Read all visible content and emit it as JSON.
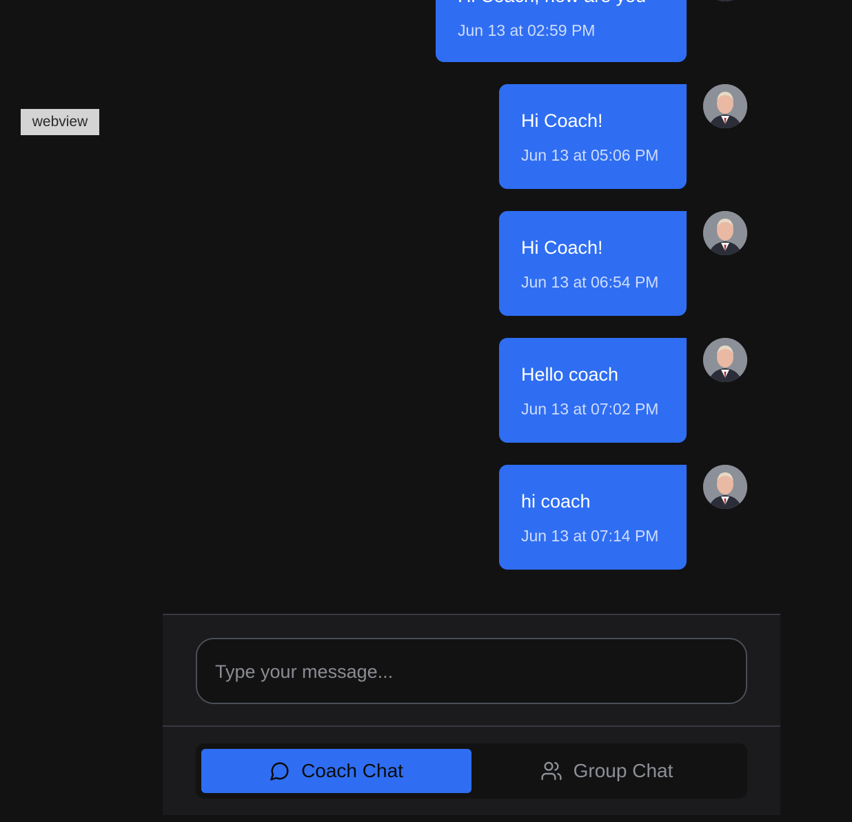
{
  "webview_label": "webview",
  "messages": [
    {
      "text": "Hi Coach, how are you",
      "time": "Jun 13 at 02:59 PM"
    },
    {
      "text": "Hi Coach!",
      "time": "Jun 13 at 05:06 PM"
    },
    {
      "text": "Hi Coach!",
      "time": "Jun 13 at 06:54 PM"
    },
    {
      "text": "Hello coach",
      "time": "Jun 13 at 07:02 PM"
    },
    {
      "text": "hi coach",
      "time": "Jun 13 at 07:14 PM"
    }
  ],
  "composer": {
    "placeholder": "Type your message..."
  },
  "tabs": {
    "coach_label": "Coach Chat",
    "coach_icon": "message-circle-icon",
    "group_label": "Group Chat",
    "group_icon": "users-icon"
  },
  "colors": {
    "background": "#121213",
    "bubble": "#2f6ef2",
    "accent": "#2f6ef2"
  }
}
